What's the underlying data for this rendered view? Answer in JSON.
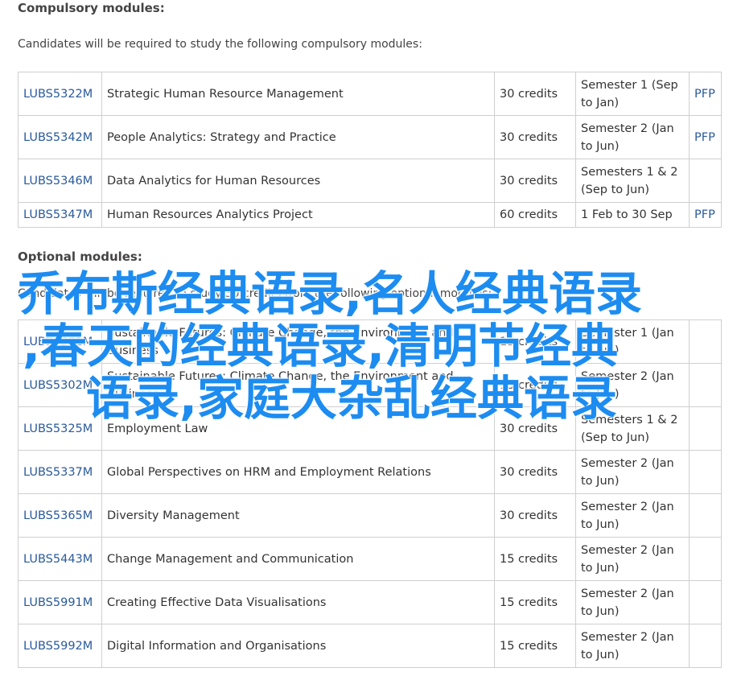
{
  "compulsory": {
    "heading": "Compulsory modules:",
    "intro": "Candidates will be required to study the following compulsory modules:",
    "rows": [
      {
        "code": "LUBS5322M",
        "title": "Strategic Human Resource Management",
        "credits": "30 credits",
        "semester": "Semester 1 (Sep to Jan)",
        "pfp": "PFP"
      },
      {
        "code": "LUBS5342M",
        "title": "People Analytics: Strategy and Practice",
        "credits": "30 credits",
        "semester": "Semester 2 (Jan to Jun)",
        "pfp": "PFP"
      },
      {
        "code": "LUBS5346M",
        "title": "Data Analytics for Human Resources",
        "credits": "30 credits",
        "semester": "Semesters 1 & 2 (Sep to Jun)",
        "pfp": ""
      },
      {
        "code": "LUBS5347M",
        "title": "Human Resources Analytics Project",
        "credits": "60 credits",
        "semester": "1 Feb to 30 Sep",
        "pfp": "PFP"
      }
    ]
  },
  "optional": {
    "heading": "Optional modules:",
    "intro": "Candidates will be required to study 30 credits from the following optional modules:",
    "rows": [
      {
        "code": "LUBS5301M",
        "title": "Sustainable Futures: Climate Change, the Environment and Business",
        "credits": "15 credits",
        "semester": "Semester 1 (Jan to Jun)",
        "pfp": ""
      },
      {
        "code": "LUBS5302M",
        "title": "Sustainable Futures: Climate Change, the Environment and Business",
        "credits": "15 credits",
        "semester": "Semester 2 (Jan to Jun)",
        "pfp": ""
      },
      {
        "code": "LUBS5325M",
        "title": "Employment Law",
        "credits": "30 credits",
        "semester": "Semesters 1 & 2 (Sep to Jun)",
        "pfp": ""
      },
      {
        "code": "LUBS5337M",
        "title": "Global Perspectives on HRM and Employment Relations",
        "credits": "30 credits",
        "semester": "Semester 2 (Jan to Jun)",
        "pfp": ""
      },
      {
        "code": "LUBS5365M",
        "title": "Diversity Management",
        "credits": "30 credits",
        "semester": "Semester 2 (Jan to Jun)",
        "pfp": ""
      },
      {
        "code": "LUBS5443M",
        "title": "Change Management and Communication",
        "credits": "15 credits",
        "semester": "Semester 2 (Jan to Jun)",
        "pfp": ""
      },
      {
        "code": "LUBS5991M",
        "title": "Creating Effective Data Visualisations",
        "credits": "15 credits",
        "semester": "Semester 2 (Jan to Jun)",
        "pfp": ""
      },
      {
        "code": "LUBS5992M",
        "title": "Digital Information and Organisations",
        "credits": "15 credits",
        "semester": "Semester 2 (Jan to Jun)",
        "pfp": ""
      }
    ]
  },
  "watermark": {
    "line1": "乔布斯经典语录,名人经典语录",
    "line2": ",春天的经典语录,清明节经典",
    "line3": "语录,家庭大杂乱经典语录"
  },
  "colors": {
    "link": "#2a5a9c",
    "watermark": "#1d8cf0",
    "border": "#cfcfcf"
  }
}
